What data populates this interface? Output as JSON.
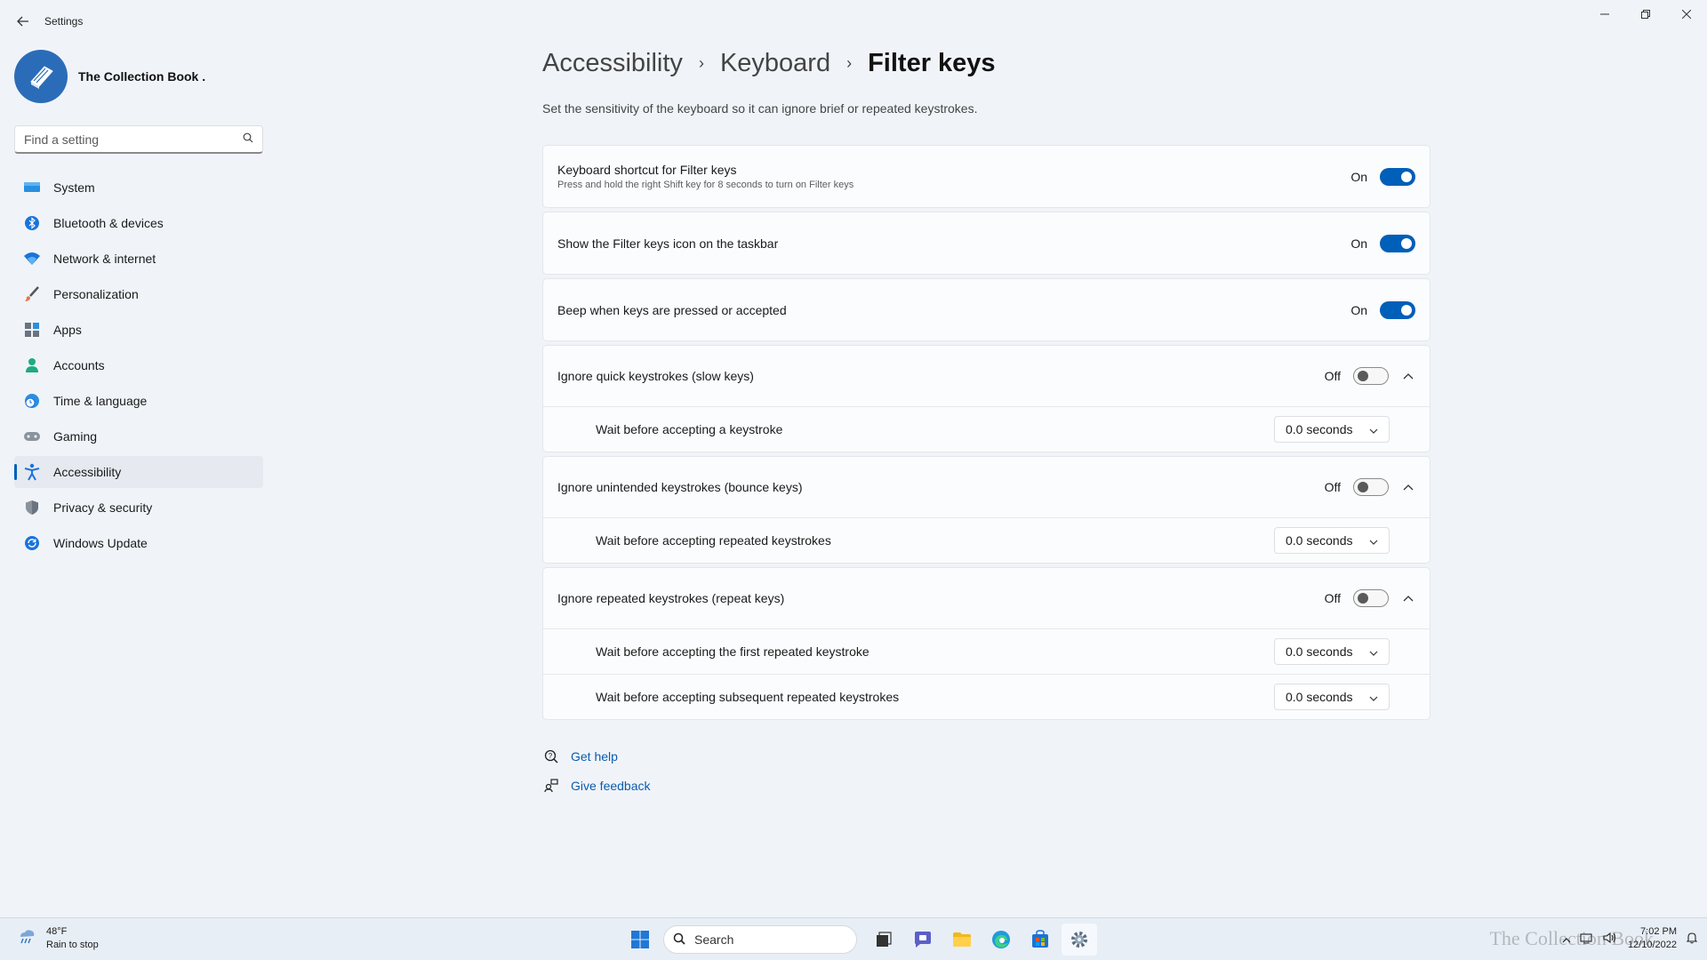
{
  "window": {
    "title": "Settings",
    "minimize": "—",
    "maximize": "❐",
    "close": "✕"
  },
  "profile": {
    "name": "The Collection Book ."
  },
  "search": {
    "placeholder": "Find a setting"
  },
  "sidebar": {
    "items": [
      {
        "label": "System",
        "icon": "system-icon"
      },
      {
        "label": "Bluetooth & devices",
        "icon": "bluetooth-icon"
      },
      {
        "label": "Network & internet",
        "icon": "wifi-icon"
      },
      {
        "label": "Personalization",
        "icon": "brush-icon"
      },
      {
        "label": "Apps",
        "icon": "apps-icon"
      },
      {
        "label": "Accounts",
        "icon": "accounts-icon"
      },
      {
        "label": "Time & language",
        "icon": "clock-globe-icon"
      },
      {
        "label": "Gaming",
        "icon": "gamepad-icon"
      },
      {
        "label": "Accessibility",
        "icon": "accessibility-icon",
        "active": true
      },
      {
        "label": "Privacy & security",
        "icon": "shield-icon"
      },
      {
        "label": "Windows Update",
        "icon": "update-icon"
      }
    ]
  },
  "breadcrumb": {
    "items": [
      "Accessibility",
      "Keyboard",
      "Filter keys"
    ],
    "separator": "›"
  },
  "description": "Set the sensitivity of the keyboard so it can ignore brief or repeated keystrokes.",
  "settings": {
    "shortcut": {
      "label": "Keyboard shortcut for Filter keys",
      "sublabel": "Press and hold the right Shift key for 8 seconds to turn on Filter keys",
      "state": "On"
    },
    "show_icon": {
      "label": "Show the Filter keys icon on the taskbar",
      "state": "On"
    },
    "beep": {
      "label": "Beep when keys are pressed or accepted",
      "state": "On"
    },
    "slow_keys": {
      "label": "Ignore quick keystrokes (slow keys)",
      "state": "Off",
      "sub": {
        "label": "Wait before accepting a keystroke",
        "value": "0.0 seconds"
      }
    },
    "bounce_keys": {
      "label": "Ignore unintended keystrokes (bounce keys)",
      "state": "Off",
      "sub": {
        "label": "Wait before accepting repeated keystrokes",
        "value": "0.0 seconds"
      }
    },
    "repeat_keys": {
      "label": "Ignore repeated keystrokes (repeat keys)",
      "state": "Off",
      "sub1": {
        "label": "Wait before accepting the first repeated keystroke",
        "value": "0.0 seconds"
      },
      "sub2": {
        "label": "Wait before accepting subsequent repeated keystrokes",
        "value": "0.0 seconds"
      }
    }
  },
  "help": {
    "get_help": "Get help",
    "give_feedback": "Give feedback"
  },
  "taskbar": {
    "weather_temp": "48°F",
    "weather_desc": "Rain to stop",
    "search_label": "Search",
    "time": "7:02 PM",
    "date": "12/10/2022",
    "watermark": "The Collection Book"
  },
  "colors": {
    "accent": "#005fb8",
    "background": "#f0f4f9"
  }
}
